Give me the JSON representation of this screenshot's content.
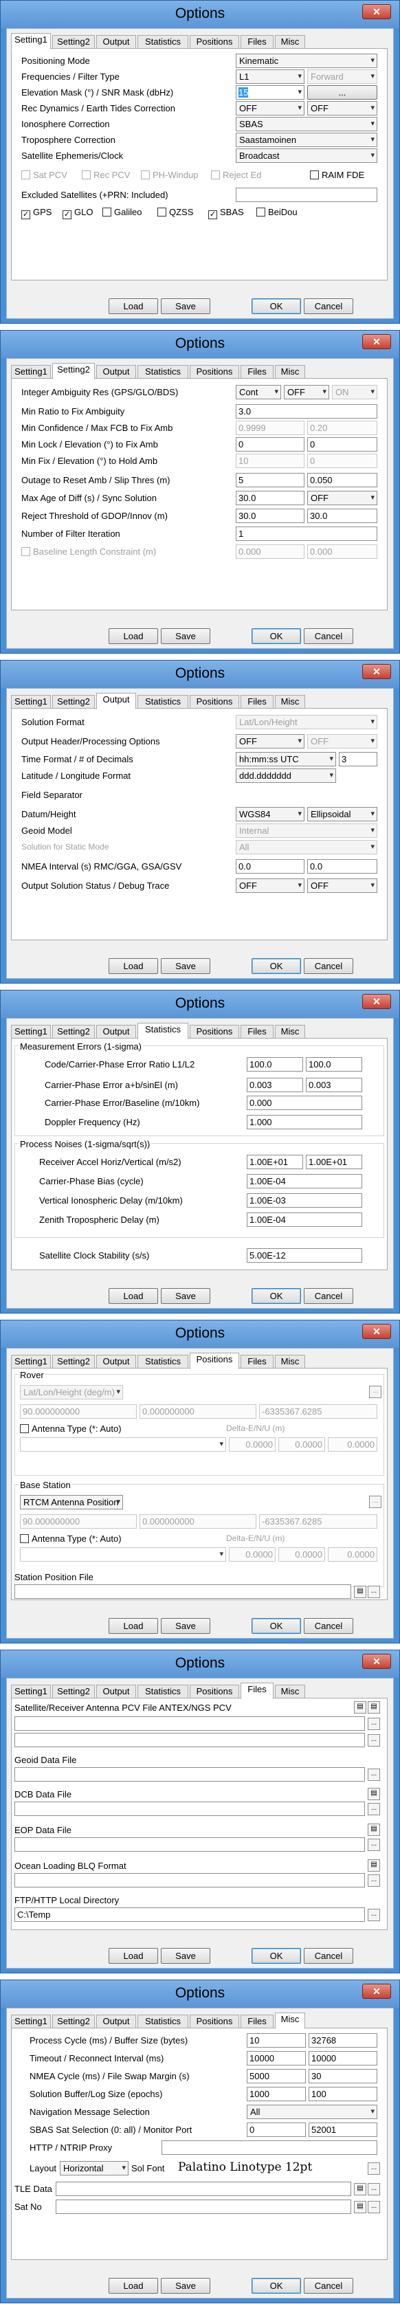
{
  "title": "Options",
  "close_glyph": "✕",
  "tabs": [
    "Setting1",
    "Setting2",
    "Output",
    "Statistics",
    "Positions",
    "Files",
    "Misc"
  ],
  "buttons": {
    "load": "Load",
    "save": "Save",
    "ok": "OK",
    "cancel": "Cancel",
    "ellipsis": "...",
    "open_glyph": "▤"
  },
  "setting1": {
    "positioning_mode": {
      "label": "Positioning Mode",
      "value": "Kinematic"
    },
    "freq_filter": {
      "label": "Frequencies / Filter Type",
      "value1": "L1",
      "value2": "Forward"
    },
    "elev_mask": {
      "label": "Elevation Mask (°) / SNR Mask (dbHz)",
      "value": "15"
    },
    "rec_dyn": {
      "label": "Rec Dynamics / Earth Tides Correction",
      "value1": "OFF",
      "value2": "OFF"
    },
    "iono": {
      "label": "Ionosphere Correction",
      "value": "SBAS"
    },
    "tropo": {
      "label": "Troposphere Correction",
      "value": "Saastamoinen"
    },
    "ephem": {
      "label": "Satellite Ephemeris/Clock",
      "value": "Broadcast"
    },
    "opts": [
      "Sat PCV",
      "Rec PCV",
      "PH-Windup",
      "Reject Ed",
      "RAIM FDE"
    ],
    "excluded": {
      "label": "Excluded Satellites (+PRN: Included)",
      "value": ""
    },
    "systems": [
      {
        "label": "GPS",
        "checked": true
      },
      {
        "label": "GLO",
        "checked": true
      },
      {
        "label": "Galileo",
        "checked": false
      },
      {
        "label": "QZSS",
        "checked": false
      },
      {
        "label": "SBAS",
        "checked": true
      },
      {
        "label": "BeiDou",
        "checked": false
      }
    ]
  },
  "setting2": {
    "amb": {
      "label": "Integer Ambiguity Res (GPS/GLO/BDS)",
      "v1": "Cont",
      "v2": "OFF",
      "v3": "ON"
    },
    "ratio": {
      "label": "Min Ratio to Fix Ambiguity",
      "value": "3.0"
    },
    "conf": {
      "label": "Min Confidence / Max FCB to Fix Amb",
      "v1": "0.9999",
      "v2": "0.20"
    },
    "lock": {
      "label": "Min Lock / Elevation (°) to Fix Amb",
      "v1": "0",
      "v2": "0"
    },
    "fix": {
      "label": "Min Fix / Elevation (°) to Hold Amb",
      "v1": "10",
      "v2": "0"
    },
    "outage": {
      "label": "Outage to Reset Amb / Slip Thres (m)",
      "v1": "5",
      "v2": "0.050"
    },
    "age": {
      "label": "Max Age of Diff (s) / Sync Solution",
      "v1": "30.0",
      "v2": "OFF"
    },
    "reject": {
      "label": "Reject Threshold of GDOP/Innov (m)",
      "v1": "30.0",
      "v2": "30.0"
    },
    "iter": {
      "label": "Number of Filter Iteration",
      "value": "1"
    },
    "baseline": {
      "label": "Baseline Length Constraint (m)",
      "v1": "0.000",
      "v2": "0.000"
    }
  },
  "output": {
    "format": {
      "label": "Solution Format",
      "value": "Lat/Lon/Height"
    },
    "header": {
      "label": "Output Header/Processing Options",
      "v1": "OFF",
      "v2": "OFF"
    },
    "time": {
      "label": "Time Format / # of Decimals",
      "v1": "hh:mm:ss UTC",
      "v2": "3"
    },
    "latlon": {
      "label": "Latitude / Longitude Format",
      "value": "ddd.ddddddd"
    },
    "sep": {
      "label": "Field Separator",
      "value": ""
    },
    "datum": {
      "label": "Datum/Height",
      "v1": "WGS84",
      "v2": "Ellipsoidal"
    },
    "geoid": {
      "label": "Geoid Model",
      "value": "Internal"
    },
    "static": {
      "label": "Solution for Static Mode",
      "value": "All"
    },
    "nmea": {
      "label": "NMEA Interval (s) RMC/GGA, GSA/GSV",
      "v1": "0.0",
      "v2": "0.0"
    },
    "status": {
      "label": "Output Solution Status / Debug Trace",
      "v1": "OFF",
      "v2": "OFF"
    }
  },
  "stats": {
    "meas_title": "Measurement Errors (1-sigma)",
    "ratio": {
      "label": "Code/Carrier-Phase Error Ratio L1/L2",
      "v1": "100.0",
      "v2": "100.0"
    },
    "cpe": {
      "label": "Carrier-Phase Error a+b/sinEl (m)",
      "v1": "0.003",
      "v2": "0.003"
    },
    "cpb": {
      "label": "Carrier-Phase Error/Baseline (m/10km)",
      "value": "0.000"
    },
    "dop": {
      "label": "Doppler Frequency (Hz)",
      "value": "1.000"
    },
    "proc_title": "Process Noises (1-sigma/sqrt(s))",
    "acc": {
      "label": "Receiver Accel Horiz/Vertical (m/s2)",
      "v1": "1.00E+01",
      "v2": "1.00E+01"
    },
    "bias": {
      "label": "Carrier-Phase Bias (cycle)",
      "value": "1.00E-04"
    },
    "iono": {
      "label": "Vertical Ionospheric Delay (m/10km)",
      "value": "1.00E-03"
    },
    "tropo": {
      "label": "Zenith Tropospheric Delay (m)",
      "value": "1.00E-04"
    },
    "clock": {
      "label": "Satellite Clock Stability (s/s)",
      "value": "5.00E-12"
    }
  },
  "positions": {
    "rover_title": "Rover",
    "rover_fmt": "Lat/Lon/Height (deg/m)",
    "rover_vals": [
      "90.000000000",
      "0.000000000",
      "-6335367.6285"
    ],
    "ant_label": "Antenna Type (*: Auto)",
    "delta_label": "Delta-E/N/U (m)",
    "delta_vals": [
      "0.0000",
      "0.0000",
      "0.0000"
    ],
    "base_title": "Base Station",
    "base_fmt": "RTCM Antenna Position",
    "base_vals": [
      "90.000000000",
      "0.000000000",
      "-6335367.6285"
    ],
    "stafile_title": "Station Position File",
    "stafile": ""
  },
  "files": {
    "antex": "Satellite/Receiver Antenna PCV File ANTEX/NGS PCV",
    "geoid": "Geoid Data File",
    "dcb": "DCB Data File",
    "eop": "EOP Data File",
    "blq": "Ocean Loading BLQ Format",
    "ftp_label": "FTP/HTTP Local Directory",
    "ftp_value": "C:\\Temp"
  },
  "misc": {
    "proc": {
      "label": "Process Cycle (ms) / Buffer Size (bytes)",
      "v1": "10",
      "v2": "32768"
    },
    "timeout": {
      "label": "Timeout / Reconnect Interval (ms)",
      "v1": "10000",
      "v2": "10000"
    },
    "nmea": {
      "label": "NMEA Cycle (ms) / File Swap Margin (s)",
      "v1": "5000",
      "v2": "30"
    },
    "buf": {
      "label": "Solution Buffer/Log Size (epochs)",
      "v1": "1000",
      "v2": "100"
    },
    "navsel": {
      "label": "Navigation Message Selection",
      "value": "All"
    },
    "sbas": {
      "label": "SBAS Sat Selection (0: all) / Monitor Port",
      "v1": "0",
      "v2": "52001"
    },
    "proxy": {
      "label": "HTTP / NTRIP Proxy",
      "value": ""
    },
    "layout": {
      "label": "Layout",
      "value": "Horizontal"
    },
    "solfont": {
      "label": "Sol Font",
      "value": "Palatino Linotype 12pt"
    },
    "tle": {
      "label": "TLE Data",
      "value": ""
    },
    "satno": {
      "label": "Sat No",
      "value": ""
    }
  }
}
